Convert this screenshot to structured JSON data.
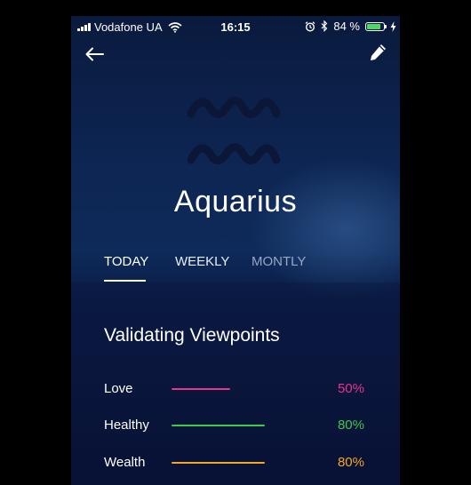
{
  "status_bar": {
    "carrier": "Vodafone UA",
    "time": "16:15",
    "battery_text": "84 %",
    "battery_level": 0.84,
    "icons": [
      "signal-icon",
      "wifi-icon",
      "alarm-icon",
      "bluetooth-icon",
      "battery-icon",
      "charging-icon"
    ]
  },
  "toolbar": {
    "back_icon": "back-arrow-icon",
    "edit_icon": "pencil-icon"
  },
  "sign": {
    "icon": "aquarius-symbol-icon",
    "name": "Aquarius",
    "color": "#0c1636"
  },
  "tabs": [
    {
      "label": "TODAY",
      "active": true
    },
    {
      "label": "WEEKLY",
      "active": false
    },
    {
      "label": "MONTLY",
      "active": false
    }
  ],
  "reading": {
    "title": "Validating Viewpoints",
    "stats": [
      {
        "label": "Love",
        "value_text": "50%",
        "value": 0.5,
        "color": "#e8358e"
      },
      {
        "label": "Healthy",
        "value_text": "80%",
        "value": 0.8,
        "color": "#3ec94a"
      },
      {
        "label": "Wealth",
        "value_text": "80%",
        "value": 0.8,
        "color": "#f6a623"
      }
    ]
  }
}
